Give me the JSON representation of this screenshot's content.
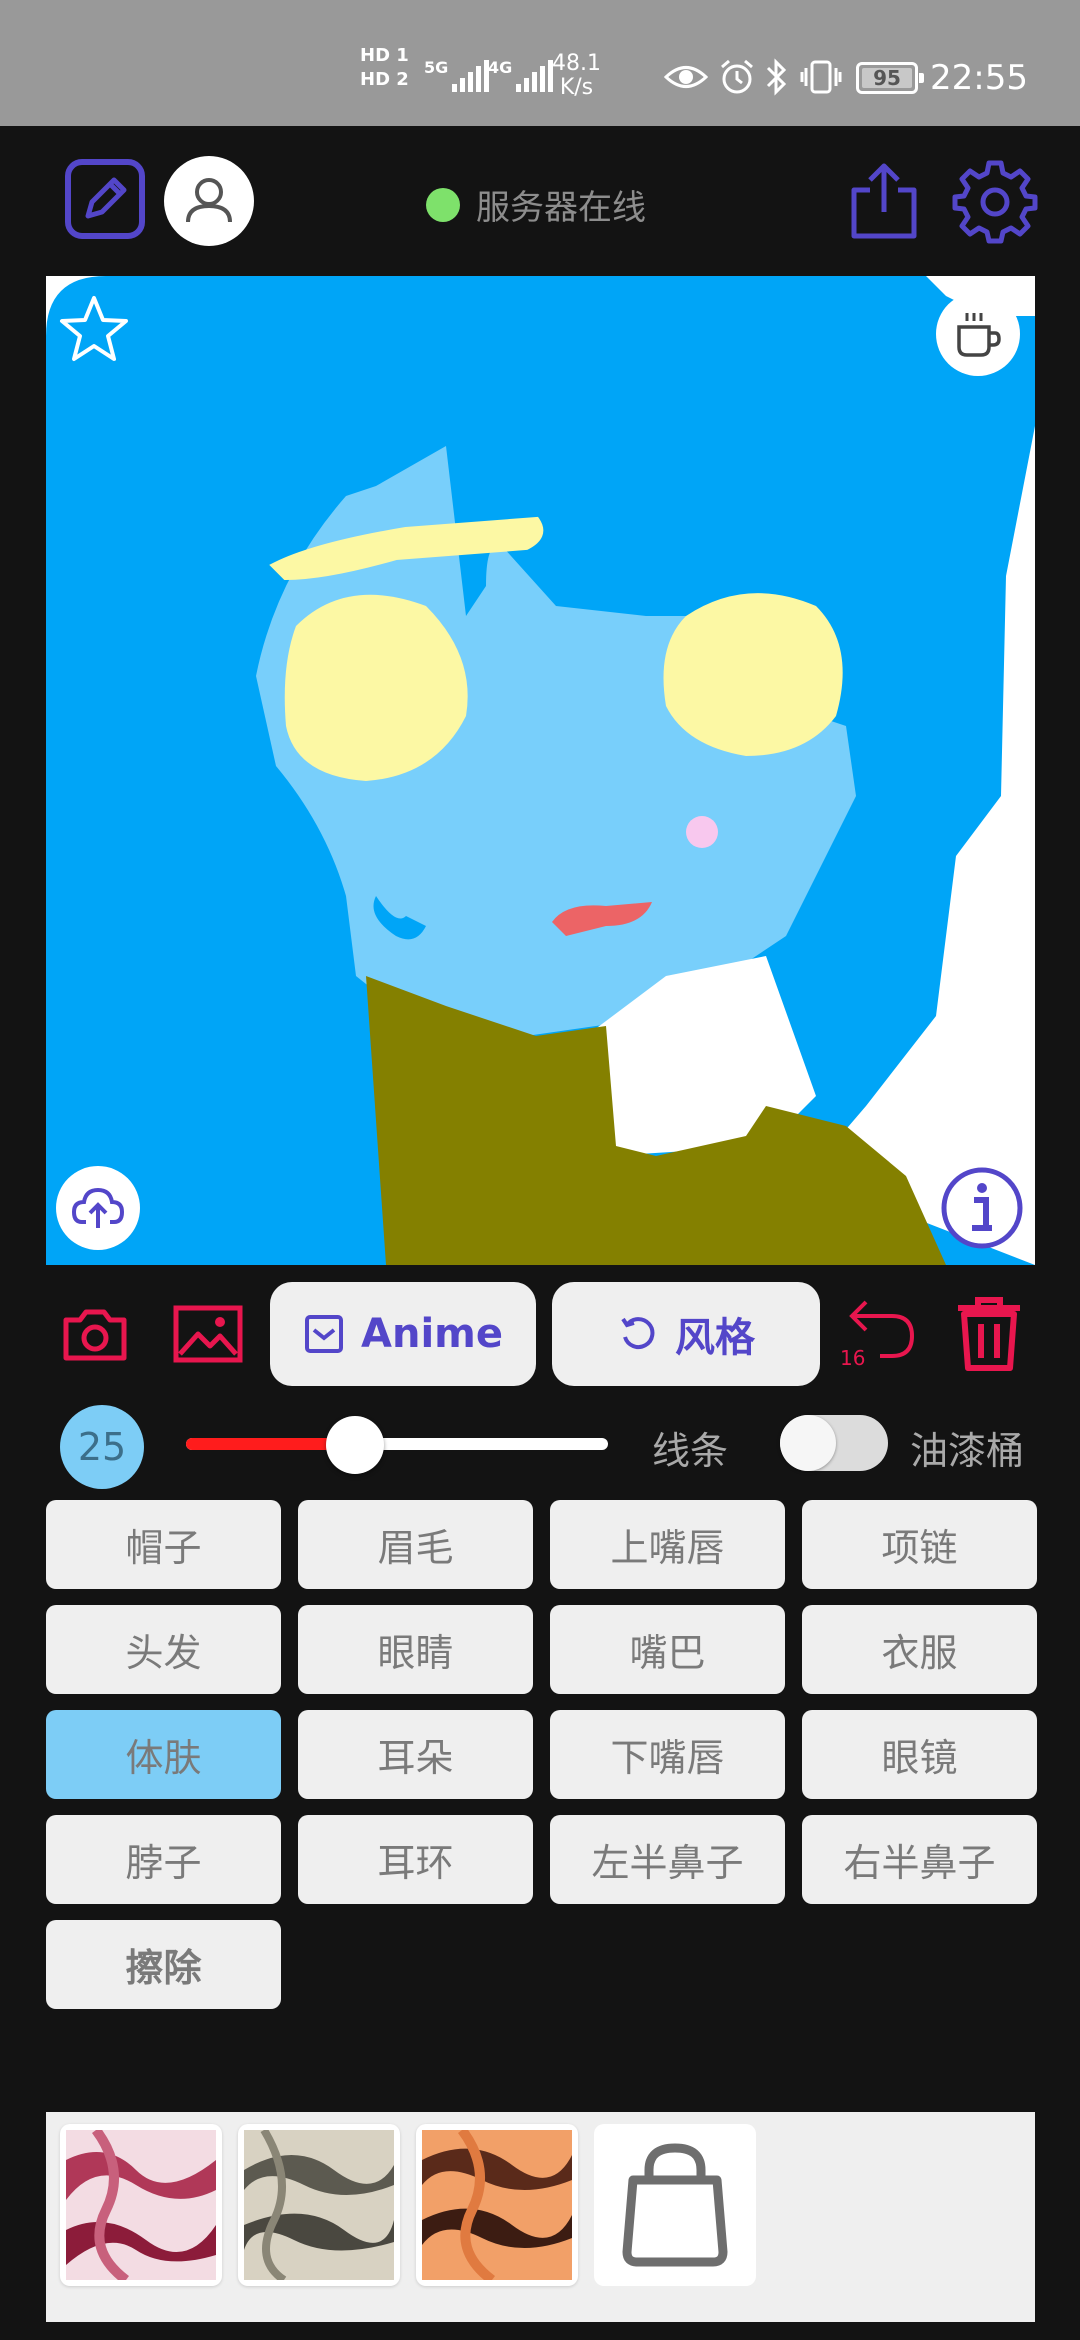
{
  "status_bar": {
    "hd1": "HD 1",
    "hd2": "HD 2",
    "net5g": "5G",
    "net4g": "4G",
    "speed_value": "48.1",
    "speed_unit": "K/s",
    "battery": "95",
    "time": "22:55"
  },
  "header": {
    "server_status": "服务器在线"
  },
  "toolbar": {
    "anime_label": "Anime",
    "style_label": "风格",
    "undo_count": "16"
  },
  "brush": {
    "size": "25",
    "slider_fraction": 0.4,
    "line_label": "线条",
    "bucket_label": "油漆桶",
    "bucket_on": false
  },
  "parts": [
    "帽子",
    "眉毛",
    "上嘴唇",
    "项链",
    "头发",
    "眼睛",
    "嘴巴",
    "衣服",
    "体肤",
    "耳朵",
    "下嘴唇",
    "眼镜",
    "脖子",
    "耳环",
    "左半鼻子",
    "右半鼻子",
    "擦除"
  ],
  "selected_part": "体肤",
  "colors": {
    "accent": "#5346c9",
    "danger": "#e8164e",
    "hair": "#00a5f7",
    "skin": "#78cffb",
    "eyes": "#fcf8a4",
    "cloth": "#848000",
    "mouth": "#ec6466",
    "selected": "#7dcdf6"
  }
}
